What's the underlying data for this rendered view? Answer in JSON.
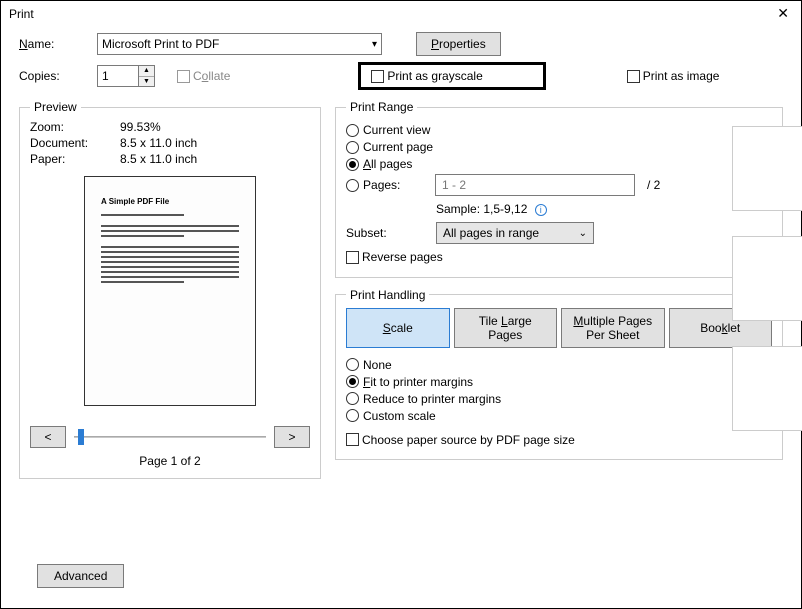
{
  "window": {
    "title": "Print"
  },
  "name": {
    "label": "Name:",
    "value": "Microsoft Print to PDF"
  },
  "properties_btn": "Properties",
  "copies": {
    "label": "Copies:",
    "value": "1"
  },
  "collate": {
    "label": "Collate"
  },
  "grayscale": {
    "label": "Print as grayscale"
  },
  "print_as_image": {
    "label": "Print as image"
  },
  "preview": {
    "legend": "Preview",
    "zoom_label": "Zoom:",
    "zoom_value": "99.53%",
    "document_label": "Document:",
    "document_value": "8.5 x 11.0 inch",
    "paper_label": "Paper:",
    "paper_value": "8.5 x 11.0 inch",
    "sample_title": "A Simple PDF File",
    "prev_btn": "<",
    "next_btn": ">",
    "page_indicator": "Page 1 of 2"
  },
  "print_range": {
    "legend": "Print Range",
    "current_view": "Current view",
    "current_page": "Current page",
    "all_pages": "All pages",
    "pages_label": "Pages:",
    "pages_value": "1 - 2",
    "total_suffix": "/ 2",
    "sample_label": "Sample: 1,5-9,12",
    "subset_label": "Subset:",
    "subset_value": "All pages in range",
    "reverse_pages": "Reverse pages"
  },
  "print_handling": {
    "legend": "Print Handling",
    "tabs": {
      "scale": "Scale",
      "tile": "Tile Large Pages",
      "multi": "Multiple Pages Per Sheet",
      "booklet": "Booklet"
    },
    "none": "None",
    "fit": "Fit to printer margins",
    "reduce": "Reduce to printer margins",
    "custom": "Custom scale",
    "choose_source": "Choose paper source by PDF page size"
  },
  "advanced_btn": "Advanced"
}
